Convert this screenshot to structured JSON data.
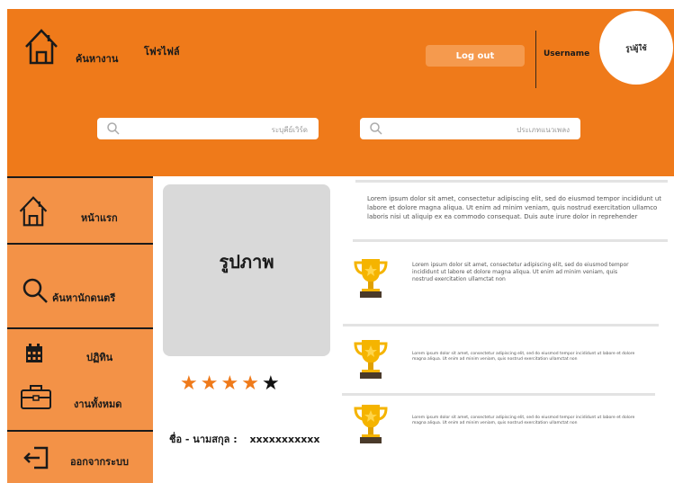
{
  "nav": {
    "jobs": "ค้นหางาน",
    "profile": "โฟรไฟล์"
  },
  "header": {
    "logout": "Log out",
    "username": "Username",
    "avatar_label": "รูปผู้ใช้"
  },
  "search": {
    "left_placeholder": "ระบุคีย์เวิร์ด",
    "right_placeholder": "ประเภทแนวเพลง"
  },
  "sidebar": {
    "items": [
      {
        "label": "หน้าแรก",
        "icon": "home-icon"
      },
      {
        "label": "ค้นหานักดนตรี",
        "icon": "search-icon"
      },
      {
        "label": "ปฏิทิน",
        "icon": "calendar-icon"
      },
      {
        "label": "งานทั้งหมด",
        "icon": "briefcase-icon"
      },
      {
        "label": "ออกจากระบบ",
        "icon": "logout-icon"
      }
    ]
  },
  "profile": {
    "photo_label": "รูปภาพ",
    "rating": 4,
    "rating_max": 5,
    "name_label": "ชื่อ - นามสกุล :",
    "name_value": "xxxxxxxxxxx"
  },
  "content": {
    "intro": "Lorem ipsum dolor sit amet, consectetur adipiscing elit, sed do eiusmod tempor incididunt ut labore et dolore magna aliqua. Ut enim ad minim veniam, quis nostrud exercitation ullamco laboris nisi ut aliquip ex ea commodo consequat. Duis aute irure dolor in reprehender",
    "awards": [
      {
        "text": "Lorem ipsum dolor sit amet, consectetur adipiscing elit, sed do eiusmod tempor incididunt ut labore et dolore magna aliqua. Ut enim ad minim veniam, quis nostrud exercitation ullamctat non"
      },
      {
        "text": "Lorem ipsum dolor sit amet, consectetur adipiscing elit, sed do eiusmod tempor incididunt ut labore et dolore magna aliqua. Ut enim ad minim veniam, quis nostrud exercitation ullamctat non"
      },
      {
        "text": "Lorem ipsum dolor sit amet, consectetur adipiscing elit, sed do eiusmod tempor incididunt ut labore et dolore magna aliqua. Ut enim ad minim veniam, quis nostrud exercitation ullamctat non"
      }
    ]
  },
  "colors": {
    "brand": "#ef7a1a",
    "sidebar": "#f39247",
    "trophy": "#f5b400"
  }
}
